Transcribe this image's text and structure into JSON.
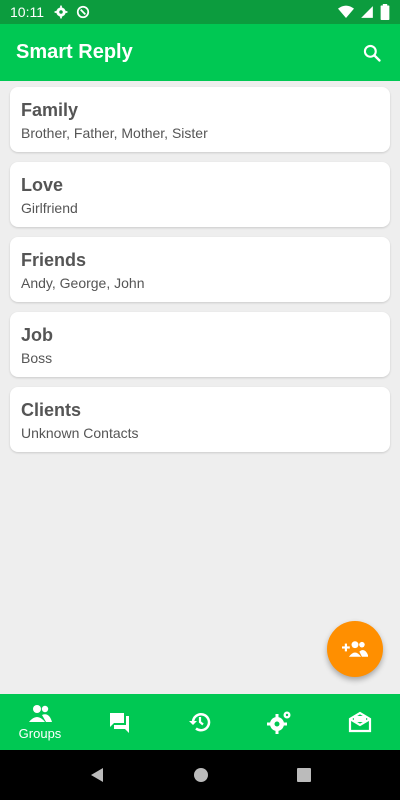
{
  "status_bar": {
    "time": "10:11",
    "icons": [
      "gear-icon",
      "vpn-icon",
      "wifi-icon",
      "signal-icon",
      "battery-icon"
    ]
  },
  "app_bar": {
    "title": "Smart Reply",
    "search_icon": "search-icon"
  },
  "groups": [
    {
      "name": "Family",
      "members": "Brother, Father, Mother, Sister"
    },
    {
      "name": "Love",
      "members": "Girlfriend"
    },
    {
      "name": "Friends",
      "members": "Andy, George, John"
    },
    {
      "name": "Job",
      "members": "Boss"
    },
    {
      "name": "Clients",
      "members": "Unknown Contacts"
    }
  ],
  "fab": {
    "icon": "add-group-icon"
  },
  "bottom_nav": {
    "items": [
      {
        "label": "Groups",
        "icon": "groups-icon",
        "active": true
      },
      {
        "label": "",
        "icon": "chat-icon"
      },
      {
        "label": "",
        "icon": "history-icon"
      },
      {
        "label": "",
        "icon": "settings-icon"
      },
      {
        "label": "",
        "icon": "mail-icon"
      }
    ]
  },
  "colors": {
    "primary": "#00c853",
    "status_bar": "#0c9c3e",
    "accent": "#ff8f00",
    "background": "#eeeeee"
  }
}
